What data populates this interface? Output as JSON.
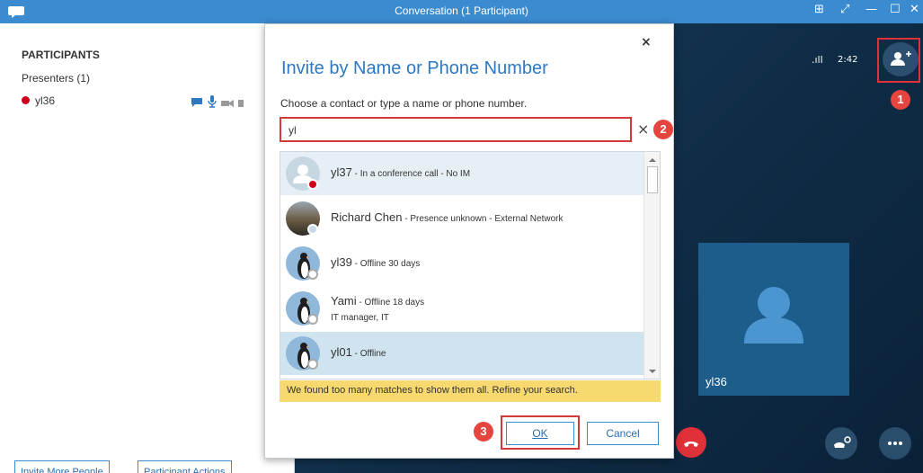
{
  "window": {
    "title": "Conversation (1 Participant)",
    "controls": [
      "⊞",
      "⤢",
      "—",
      "☐",
      "✕"
    ]
  },
  "left_panel": {
    "heading": "PARTICIPANTS",
    "presenters_label": "Presenters (1)",
    "participant_name": "yl36",
    "invite_button": "Invite More People",
    "actions_button": "Participant Actions"
  },
  "call": {
    "signal_icon": "signal-bars-icon",
    "signal_text": ".ıll",
    "time": "2:42",
    "tile_name": "yl36"
  },
  "dialog": {
    "close": "×",
    "title": "Invite by Name or Phone Number",
    "instruction": "Choose a contact or type a name or phone number.",
    "search_value": "yl",
    "clear": "×",
    "results": [
      {
        "name": "yl37",
        "status": " - In a conference call - No IM",
        "sub": "",
        "presence": "busy"
      },
      {
        "name": "Richard Chen",
        "status": " - Presence unknown - External Network",
        "sub": "",
        "presence": "unknown"
      },
      {
        "name": "yl39",
        "status": " - Offline 30 days",
        "sub": "",
        "presence": "offline"
      },
      {
        "name": "Yami",
        "status": " - Offline 18 days",
        "sub": "IT manager, IT",
        "presence": "offline"
      },
      {
        "name": "yl01",
        "status": " - Offline",
        "sub": "",
        "presence": "offline"
      }
    ],
    "warning": "We found too many matches to show them all. Refine your search.",
    "ok": "OK",
    "cancel": "Cancel"
  },
  "annotations": {
    "step1": "1",
    "step2": "2",
    "step3": "3"
  },
  "colors": {
    "accent": "#3b8bd0",
    "busy": "#d0021b",
    "annotation": "#e5453e",
    "warning": "#f8d96f"
  }
}
